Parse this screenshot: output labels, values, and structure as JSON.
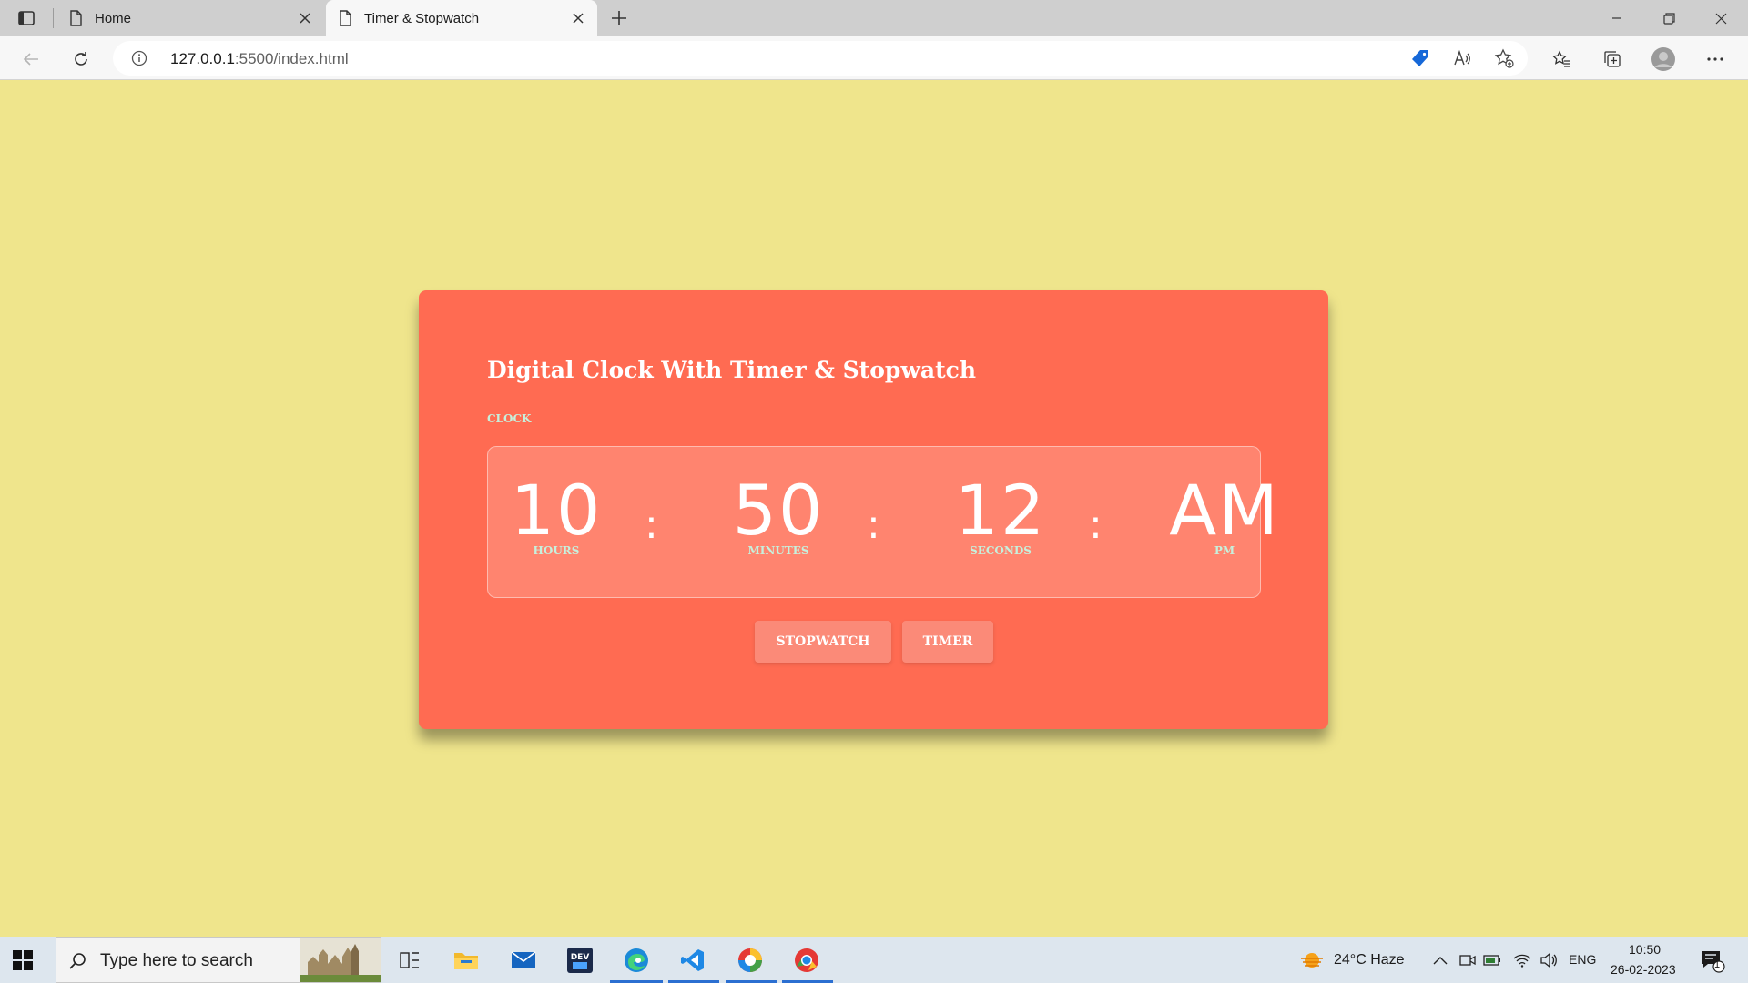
{
  "browser": {
    "tabs": [
      {
        "title": "Home",
        "active": false
      },
      {
        "title": "Timer & Stopwatch",
        "active": true
      }
    ],
    "url_host": "127.0.0.1",
    "url_path": ":5500/index.html"
  },
  "page": {
    "title": "Digital Clock With Timer & Stopwatch",
    "section_label": "CLOCK",
    "clock": {
      "hours": "10",
      "hours_label": "HOURS",
      "minutes": "50",
      "minutes_label": "MINUTES",
      "seconds": "12",
      "seconds_label": "SECONDS",
      "period": "AM",
      "period_label": "PM",
      "separator": ":"
    },
    "buttons": {
      "stopwatch": "STOPWATCH",
      "timer": "TIMER"
    }
  },
  "taskbar": {
    "search_placeholder": "Type here to search",
    "weather": "24°C  Haze",
    "language": "ENG",
    "time": "10:50",
    "date": "26-02-2023",
    "notification_count": "1"
  },
  "colors": {
    "page_bg": "#efe58c",
    "card_bg": "#ff6b52",
    "accent_label": "#c7f0dc",
    "button_bg": "#fb8a78"
  }
}
